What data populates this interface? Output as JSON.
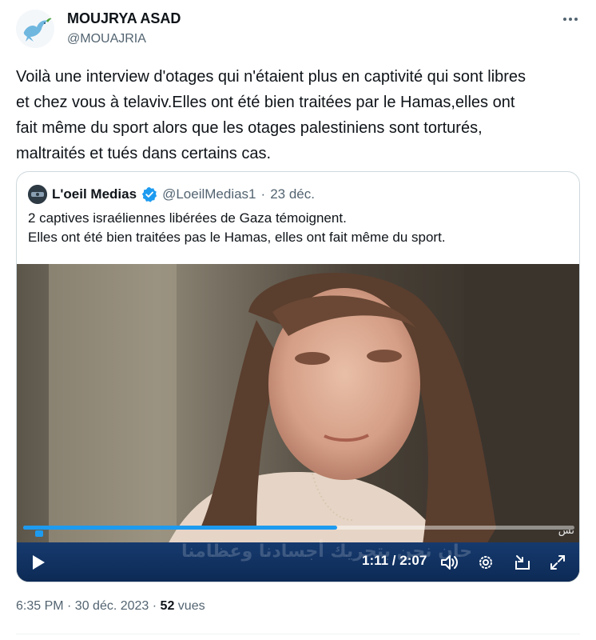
{
  "author": {
    "name": "MOUJRYA ASAD",
    "handle": "@MOUAJRIA"
  },
  "tweet": {
    "text": "Voilà une interview d'otages qui n'étaient plus en captivité qui sont libres\net chez vous à telaviv.Elles ont été bien traitées par le Hamas,elles ont\nfait même du sport alors que les otages palestiniens sont torturés,\nmaltraités et tués dans certains cas.",
    "more_label": "···"
  },
  "quoted": {
    "name": "L'oeil Medias",
    "handle": "@LoeilMedias1",
    "separator": "·",
    "date": "23 déc.",
    "text": "2 captives israéliennes libérées de Gaza témoignent.\nElles ont été bien traitées pas le Hamas, elles ont fait même du sport."
  },
  "video": {
    "time": "1:11 / 2:07",
    "progress": 0.57,
    "overlay_text": "حان نحن بتحريك أجسادنا وعظامنا",
    "brand_mark": "ىس"
  },
  "meta": {
    "timestamp": "6:35 PM · 30 déc. 2023 · ",
    "views_count": "52",
    "views_label": " vues"
  },
  "colors": {
    "accent": "#1d9bf0",
    "text_primary": "#0f1419",
    "text_secondary": "#536471",
    "control_bar": "#0d2a55"
  },
  "icons": {
    "avatar": "dove-icon",
    "more": "more-icon",
    "verified": "verified-badge-icon",
    "play": "play-icon",
    "volume": "volume-icon",
    "settings": "gear-icon",
    "pip": "picture-in-picture-icon",
    "fullscreen": "fullscreen-icon"
  }
}
